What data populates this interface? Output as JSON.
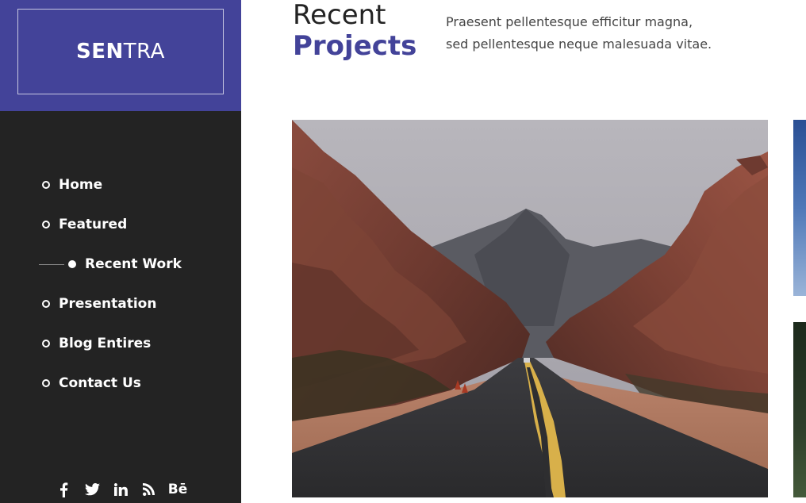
{
  "brand": {
    "bold": "SEN",
    "light": "TRA"
  },
  "nav": {
    "items": [
      {
        "label": "Home",
        "active": false
      },
      {
        "label": "Featured",
        "active": false
      },
      {
        "label": "Recent Work",
        "active": true
      },
      {
        "label": "Presentation",
        "active": false
      },
      {
        "label": "Blog Entires",
        "active": false
      },
      {
        "label": "Contact Us",
        "active": false
      }
    ]
  },
  "social": {
    "behance_label": "Bē",
    "icons": [
      "facebook-icon",
      "twitter-icon",
      "linkedin-icon",
      "rss-icon",
      "behance-icon"
    ]
  },
  "section": {
    "title_line1": "Recent",
    "title_line2": "Projects",
    "description_line1": "Praesent pellentesque efficitur magna,",
    "description_line2": "sed pellentesque neque malesuada vitae."
  },
  "colors": {
    "accent": "#434399",
    "sidebar_bg": "#232323",
    "text_dark": "#232323",
    "text_body": "#444444"
  }
}
